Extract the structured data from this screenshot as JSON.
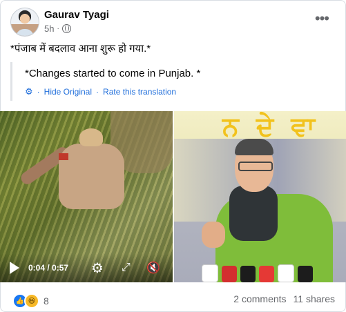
{
  "post": {
    "author": "Gaurav Tyagi",
    "time": "5h",
    "separator": "·",
    "text": "*पंजाब में बदलाव आना शुरू हो गया.*"
  },
  "translation": {
    "text": "*Changes started to come in Punjab. *",
    "hide_label": "Hide Original",
    "separator": "·",
    "rate_label": "Rate this translation"
  },
  "video": {
    "time": "0:04 / 0:57"
  },
  "photo": {
    "banner_text": "ਨ ਦੇ ਵਾ"
  },
  "footer": {
    "reaction_count": "8",
    "comments": "2 comments",
    "shares": "11 shares"
  },
  "colors": {
    "link": "#216fdb",
    "like": "#1877f2",
    "haha": "#f7b928",
    "muted_text": "#65676b"
  },
  "icons": [
    "globe-icon",
    "more-icon",
    "gear-icon",
    "play-icon",
    "settings-icon",
    "fullscreen-icon",
    "mute-icon",
    "like-icon",
    "haha-icon"
  ]
}
